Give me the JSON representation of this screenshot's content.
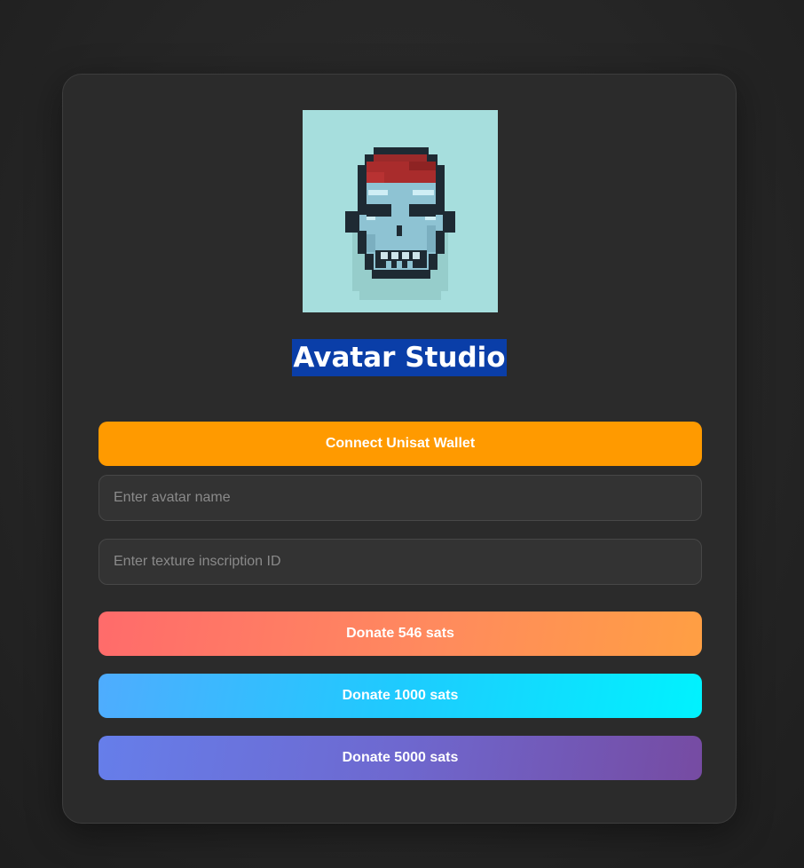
{
  "app": {
    "title": "Avatar Studio"
  },
  "avatar": {
    "icon": "pixel-skull-avatar",
    "background_color": "#a6dedd"
  },
  "wallet": {
    "connect_label": "Connect Unisat Wallet"
  },
  "form": {
    "name_placeholder": "Enter avatar name",
    "name_value": "",
    "texture_placeholder": "Enter texture inscription ID",
    "texture_value": ""
  },
  "donations": [
    {
      "label": "Donate 546 sats"
    },
    {
      "label": "Donate 1000 sats"
    },
    {
      "label": "Donate 5000 sats"
    }
  ],
  "colors": {
    "page_background": "#262626",
    "card_background": "#2b2b2b",
    "title_highlight": "#0a3ea8",
    "connect_button": "#ff9a00",
    "donate_546_gradient": [
      "#ff6b6b",
      "#ff9f43"
    ],
    "donate_1000_gradient": [
      "#4facfe",
      "#00f2fe"
    ],
    "donate_5000_gradient": [
      "#667eea",
      "#764ba2"
    ]
  }
}
